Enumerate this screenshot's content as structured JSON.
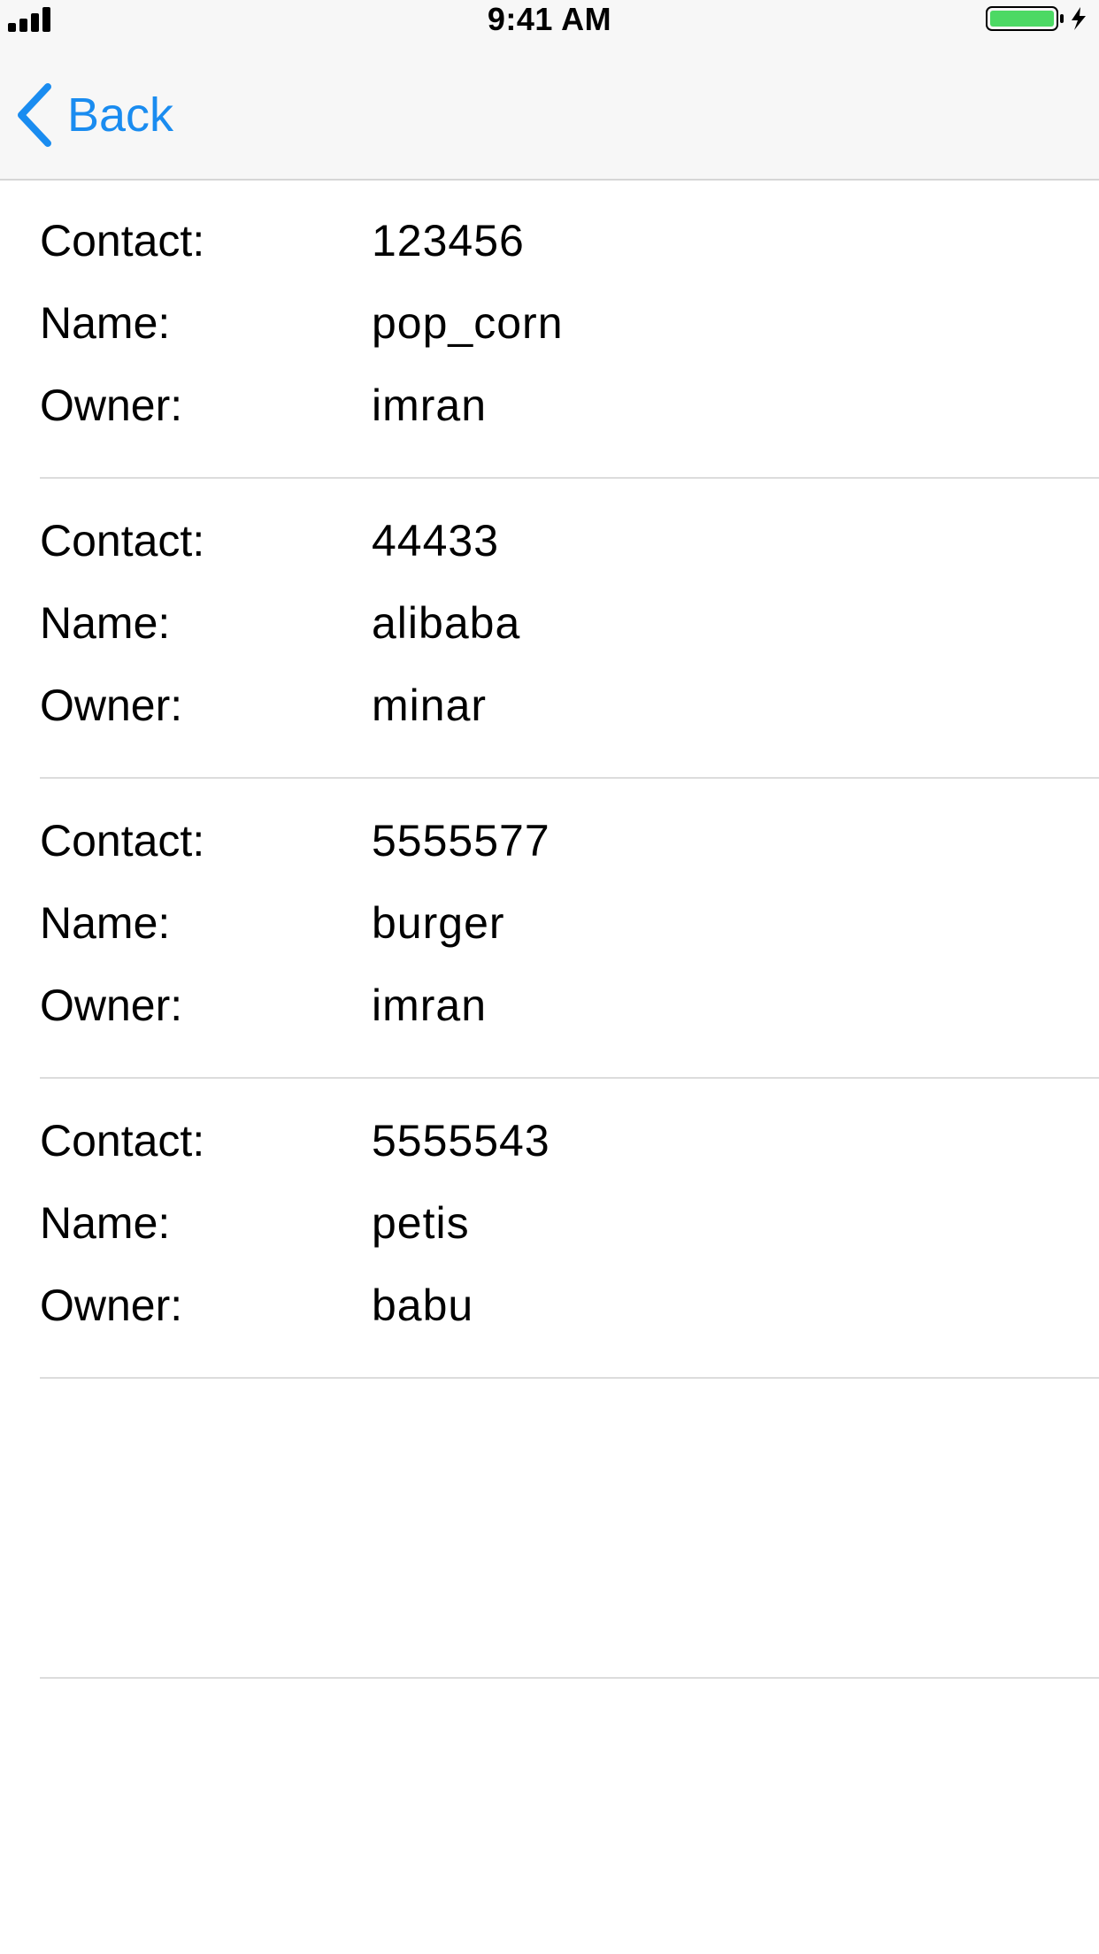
{
  "status_bar": {
    "time": "9:41 AM",
    "signal_icon": "cellular-signal-icon",
    "battery_icon": "battery-charging-icon",
    "battery_color": "#4cd964"
  },
  "nav": {
    "back_label": "Back",
    "back_icon": "chevron-left-icon",
    "accent_color": "#1a8cf0"
  },
  "labels": {
    "contact": "Contact:",
    "name": "Name:",
    "owner": "Owner:"
  },
  "restaurants": [
    {
      "contact": "123456",
      "name": "pop_corn",
      "owner": "imran"
    },
    {
      "contact": "44433",
      "name": "alibaba",
      "owner": "minar"
    },
    {
      "contact": "5555577",
      "name": "burger",
      "owner": "imran"
    },
    {
      "contact": "5555543",
      "name": "petis",
      "owner": "babu"
    }
  ]
}
